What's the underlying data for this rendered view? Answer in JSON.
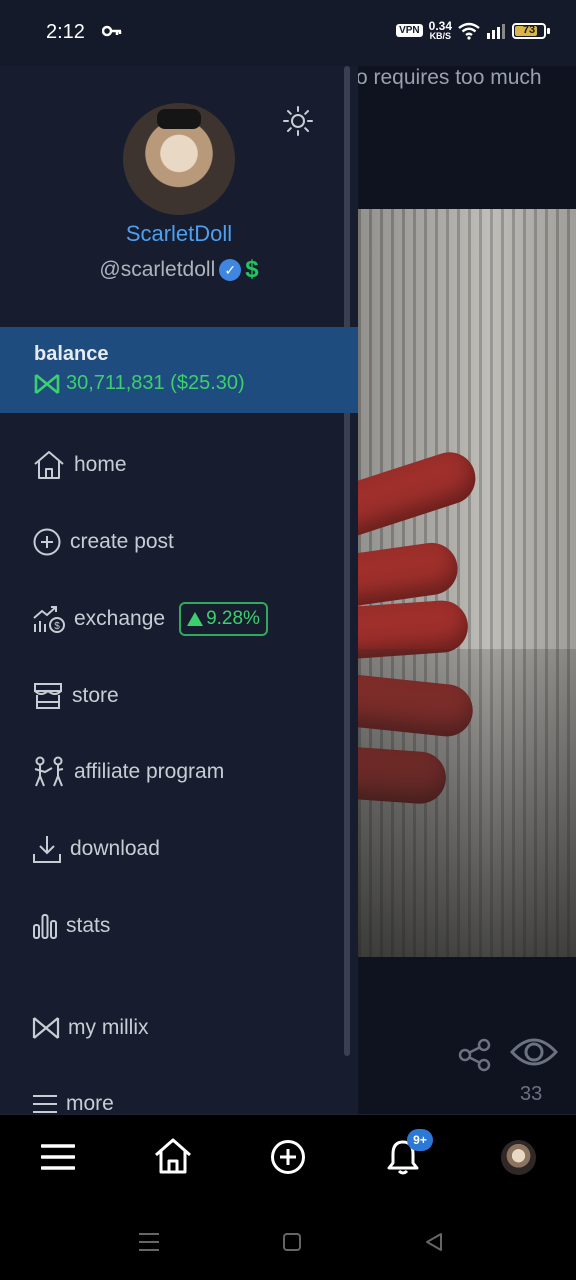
{
  "status_bar": {
    "time": "2:12",
    "vpn": "VPN",
    "net_speed": "0.34",
    "net_unit": "KB/S",
    "battery": "73",
    "battery_level": 0.73
  },
  "background_feed": {
    "post_text": "o requires too much",
    "views": "33"
  },
  "profile": {
    "display_name": "ScarletDoll",
    "handle": "@scarletdoll"
  },
  "balance": {
    "label": "balance",
    "amount": "30,711,831 ($25.30)"
  },
  "menu": {
    "home": "home",
    "create_post": "create post",
    "exchange": "exchange",
    "exchange_change": "9.28%",
    "store": "store",
    "affiliate": "affiliate program",
    "download": "download",
    "stats": "stats",
    "my_millix": "my millix",
    "more": "more"
  },
  "bottom_nav": {
    "notification_count": "9+"
  },
  "colors": {
    "accent_blue": "#4d9ff0",
    "balance_bg": "#1f4c7e",
    "positive_green": "#3ccf6e",
    "drawer_bg": "#171d2e"
  }
}
